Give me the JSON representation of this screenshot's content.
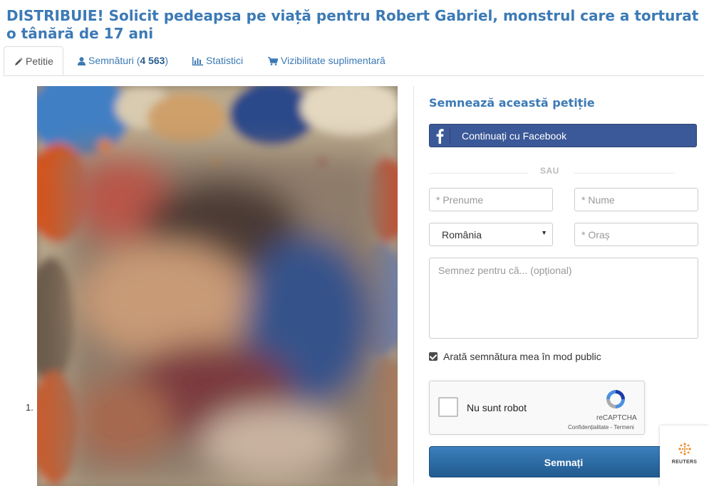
{
  "page": {
    "title": "DISTRIBUIE! Solicit pedeapsa pe viață pentru Robert Gabriel, monstrul care a torturat o tânără de 17 ani"
  },
  "tabs": [
    {
      "label": "Petitie",
      "icon": "pencil-icon",
      "active": true
    },
    {
      "label": "Semnături (",
      "count": "4 563",
      "suffix": ")",
      "icon": "user-icon"
    },
    {
      "label": "Statistici",
      "icon": "bar-chart-icon"
    },
    {
      "label": "Vizibilitate suplimentară",
      "icon": "cart-icon"
    }
  ],
  "content": {
    "list_number": "1."
  },
  "form": {
    "title": "Semnează această petiție",
    "facebook_button": "Continuați cu Facebook",
    "separator": "SAU",
    "first_name_placeholder": "* Prenume",
    "last_name_placeholder": "* Nume",
    "country_value": "România",
    "city_placeholder": "* Oraș",
    "comment_placeholder": "Semnez pentru că... (opțional)",
    "public_checkbox_label": "Arată semnătura mea în mod public",
    "public_checkbox_checked": true,
    "captcha": {
      "label": "Nu sunt robot",
      "brand": "reCAPTCHA",
      "terms": "Confidențialitate - Termeni"
    },
    "submit_button": "Semnați"
  },
  "widget": {
    "reuters_label": "REUTERS"
  },
  "colors": {
    "accent": "#3c7ab5",
    "facebook": "#3b5998",
    "submit": "#2b6ca8"
  }
}
